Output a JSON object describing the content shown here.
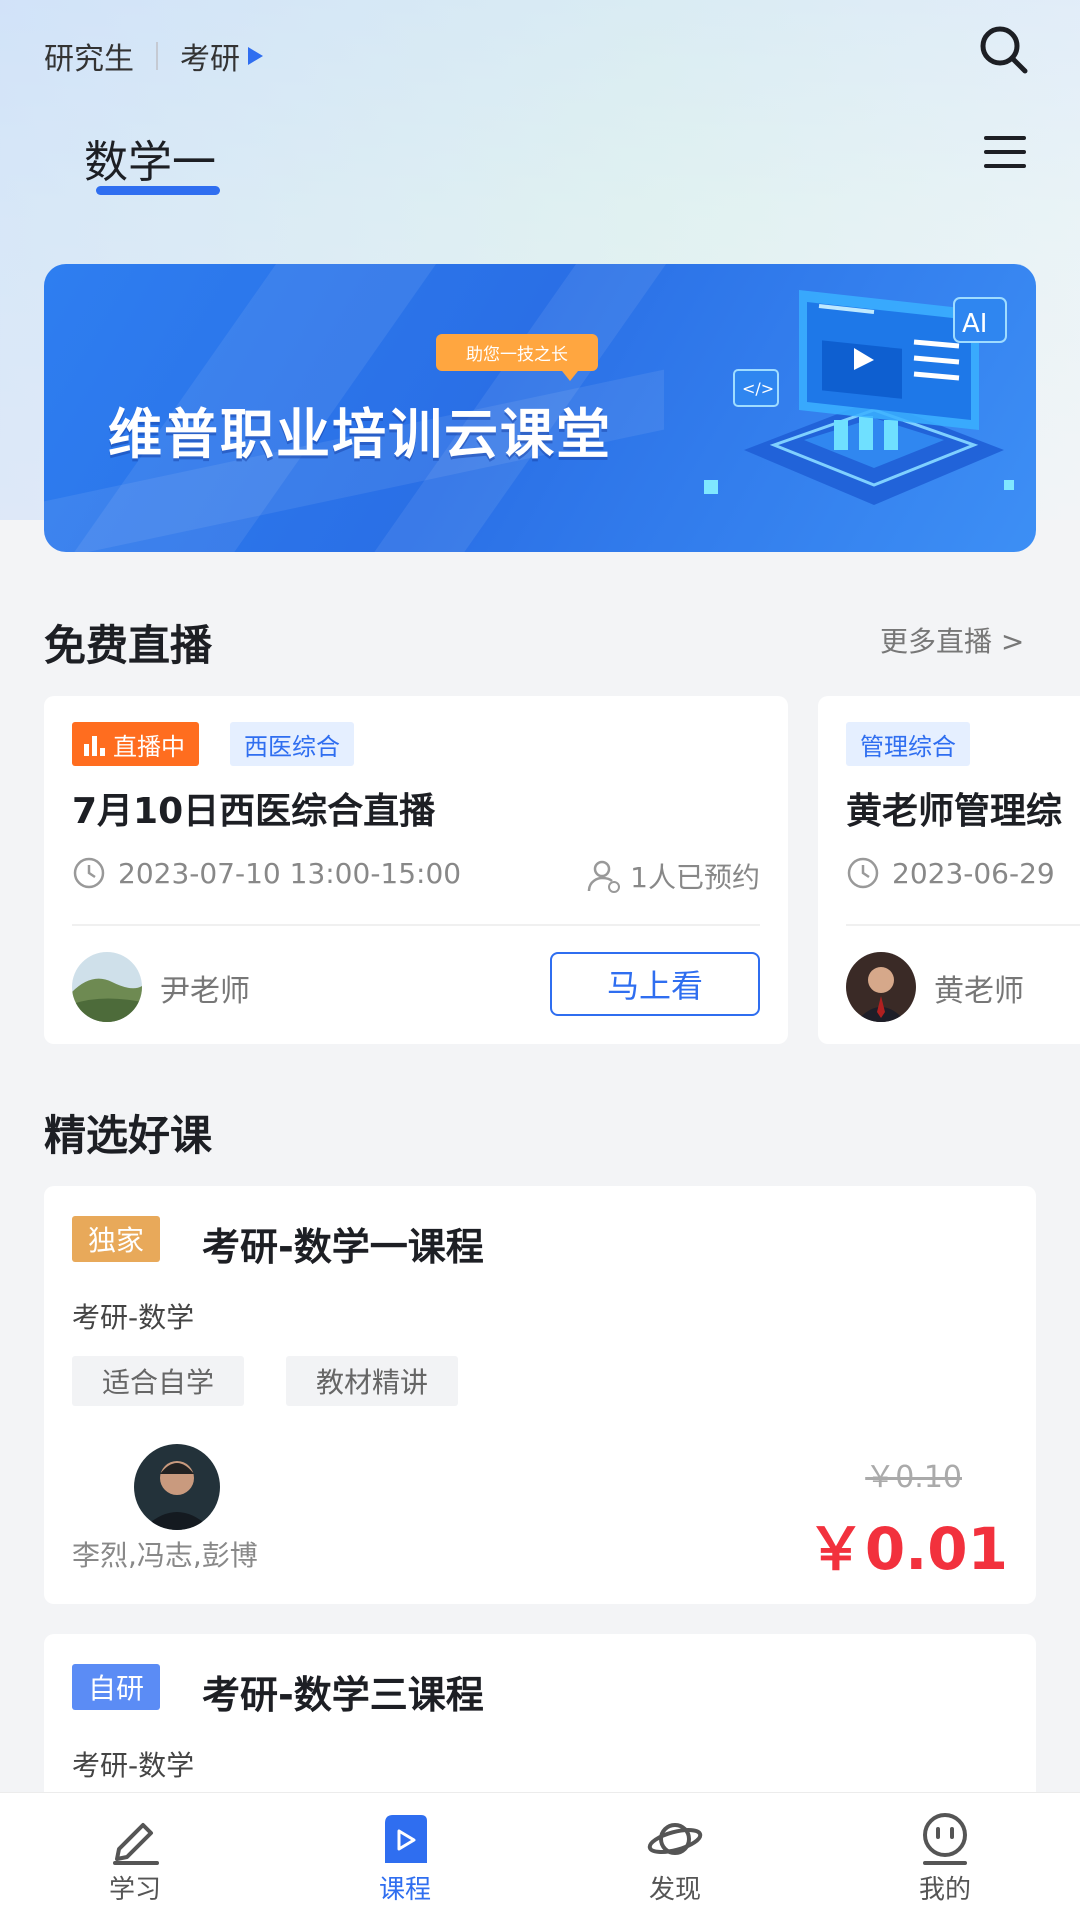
{
  "header": {
    "crumb1": "研究生",
    "crumb2": "考研",
    "subject": "数学一"
  },
  "banner": {
    "tag": "助您一技之长",
    "title": "维普职业培训云课堂",
    "ai_label": "AI"
  },
  "live": {
    "section_title": "免费直播",
    "more_label": "更多直播 >",
    "cards": [
      {
        "status": "直播中",
        "category": "西医综合",
        "title": "7月10日西医综合直播",
        "time": "2023-07-10 13:00-15:00",
        "reserved": "1人已预约",
        "teacher": "尹老师",
        "button": "马上看"
      },
      {
        "category": "管理综合",
        "title": "黄老师管理综",
        "time": "2023-06-29",
        "teacher": "黄老师"
      }
    ]
  },
  "courses": {
    "section_title": "精选好课",
    "items": [
      {
        "badge": "独家",
        "title": "考研-数学一课程",
        "subtitle": "考研-数学",
        "tags": [
          "适合自学",
          "教材精讲"
        ],
        "teachers": "李烈,冯志,彭博",
        "price_old": "￥0.10",
        "price_now": "￥0.01"
      },
      {
        "badge": "自研",
        "title": "考研-数学三课程",
        "subtitle": "考研-数学"
      }
    ]
  },
  "tabs": [
    {
      "label": "学习",
      "icon": "pen-icon"
    },
    {
      "label": "课程",
      "icon": "play-icon"
    },
    {
      "label": "发现",
      "icon": "planet-icon"
    },
    {
      "label": "我的",
      "icon": "smiley-icon"
    }
  ],
  "colors": {
    "accent": "#2f6ef0",
    "live_badge": "#ff6d1f",
    "price": "#f2313d",
    "exclusive_badge": "#e8a95a",
    "self_badge": "#5b8cf5"
  }
}
